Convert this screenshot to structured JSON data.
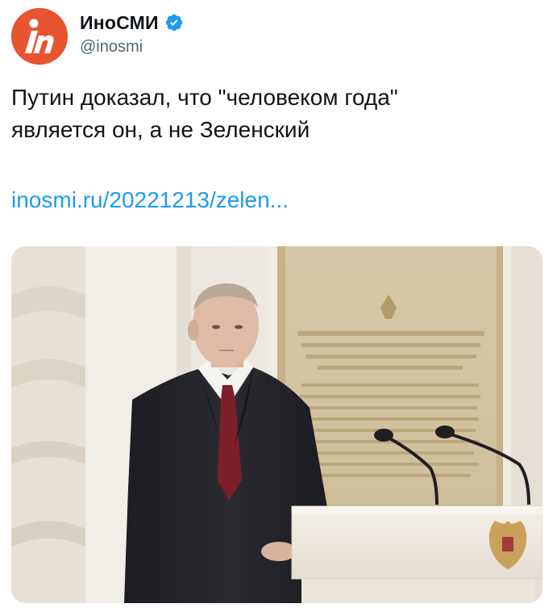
{
  "tweet": {
    "author": {
      "display_name": "ИноСМИ",
      "handle": "@inosmi",
      "avatar_icon": "inosmi-logo-icon",
      "avatar_color": "#e8542f",
      "verified_icon": "verified-badge-icon",
      "verified_color": "#1d9bf0"
    },
    "text_line_1": "Путин доказал, что \"человеком года\"",
    "text_line_2": "является он, а не Зеленский",
    "link": "inosmi.ru/20221213/zelen...",
    "link_color": "#1d9bf0",
    "media": {
      "type": "photo"
    }
  }
}
